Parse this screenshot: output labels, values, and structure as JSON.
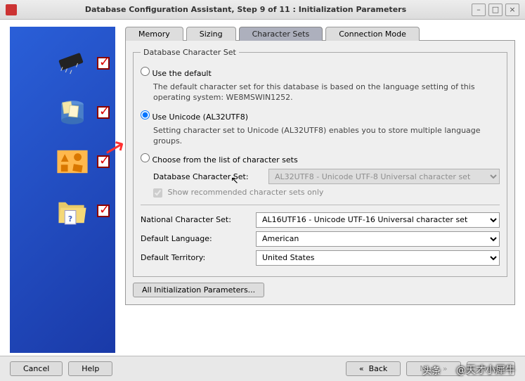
{
  "window": {
    "title": "Database Configuration Assistant, Step 9 of 11 : Initialization Parameters"
  },
  "tabs": {
    "memory": "Memory",
    "sizing": "Sizing",
    "charsets": "Character Sets",
    "connmode": "Connection Mode"
  },
  "fs": {
    "legend": "Database Character Set",
    "opt1": "Use the default",
    "opt1desc": "The default character set for this database is based on the language setting of this operating system: WE8MSWIN1252.",
    "opt2": "Use Unicode (AL32UTF8)",
    "opt2desc": "Setting character set to Unicode (AL32UTF8) enables you to store multiple language groups.",
    "opt3": "Choose from the list of character sets",
    "dbcslbl": "Database Character Set:",
    "dbcsval": "AL32UTF8 - Unicode UTF-8 Universal character set",
    "showrec": "Show recommended character sets only"
  },
  "rows": {
    "ncslbl": "National Character Set:",
    "ncsval": "AL16UTF16 - Unicode UTF-16 Universal character set",
    "langlbl": "Default Language:",
    "langval": "American",
    "terrlbl": "Default Territory:",
    "terrval": "United States"
  },
  "allparams": "All Initialization Parameters...",
  "footer": {
    "cancel": "Cancel",
    "help": "Help",
    "back": "Back",
    "next": "Next",
    "finish": "Finish"
  },
  "watermark": {
    "a": "头条",
    "b": "@天才小犀牛"
  }
}
